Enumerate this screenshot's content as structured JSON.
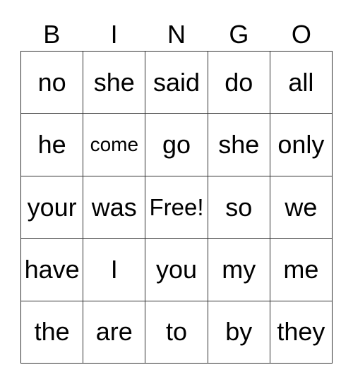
{
  "card": {
    "title": "BINGO",
    "header_letters": [
      "B",
      "I",
      "N",
      "G",
      "O"
    ],
    "colors": {
      "background": "#ffffff",
      "border": "#333333",
      "text": "#000000"
    },
    "rows": [
      [
        {
          "text": "no",
          "size": "normal",
          "free": false
        },
        {
          "text": "she",
          "size": "normal",
          "free": false
        },
        {
          "text": "said",
          "size": "normal",
          "free": false
        },
        {
          "text": "do",
          "size": "normal",
          "free": false
        },
        {
          "text": "all",
          "size": "normal",
          "free": false
        }
      ],
      [
        {
          "text": "he",
          "size": "normal",
          "free": false
        },
        {
          "text": "come",
          "size": "small",
          "free": false
        },
        {
          "text": "go",
          "size": "normal",
          "free": false
        },
        {
          "text": "she",
          "size": "normal",
          "free": false
        },
        {
          "text": "only",
          "size": "normal",
          "free": false
        }
      ],
      [
        {
          "text": "your",
          "size": "normal",
          "free": false
        },
        {
          "text": "was",
          "size": "normal",
          "free": false
        },
        {
          "text": "Free!",
          "size": "medium",
          "free": true
        },
        {
          "text": "so",
          "size": "normal",
          "free": false
        },
        {
          "text": "we",
          "size": "normal",
          "free": false
        }
      ],
      [
        {
          "text": "have",
          "size": "normal",
          "free": false
        },
        {
          "text": "I",
          "size": "normal",
          "free": false
        },
        {
          "text": "you",
          "size": "normal",
          "free": false
        },
        {
          "text": "my",
          "size": "normal",
          "free": false
        },
        {
          "text": "me",
          "size": "normal",
          "free": false
        }
      ],
      [
        {
          "text": "the",
          "size": "normal",
          "free": false
        },
        {
          "text": "are",
          "size": "normal",
          "free": false
        },
        {
          "text": "to",
          "size": "normal",
          "free": false
        },
        {
          "text": "by",
          "size": "normal",
          "free": false
        },
        {
          "text": "they",
          "size": "normal",
          "free": false
        }
      ]
    ]
  }
}
